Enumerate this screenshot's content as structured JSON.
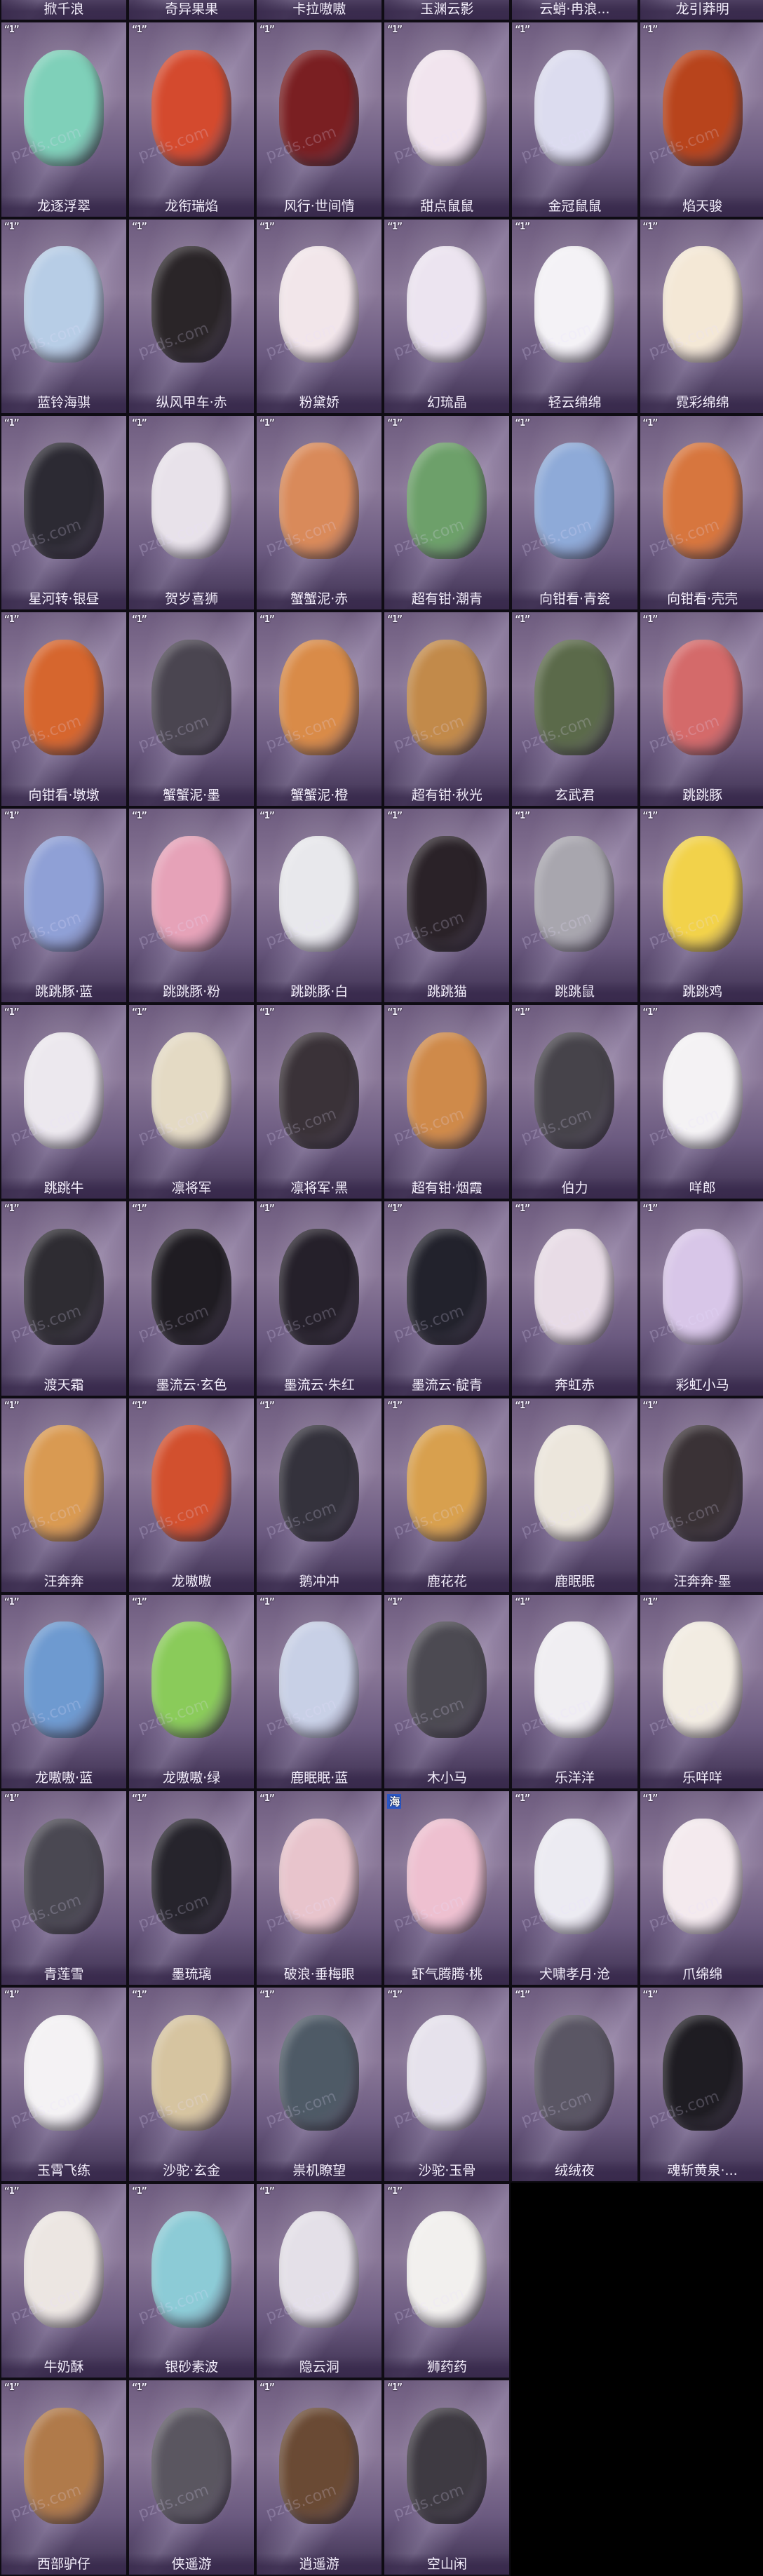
{
  "cards": [
    {
      "label": "掀千浪",
      "tag": "",
      "art": "#8aa1b5"
    },
    {
      "label": "奇异果果",
      "tag": "",
      "art": "#9ab56a"
    },
    {
      "label": "卡拉嗷嗷",
      "tag": "",
      "art": "#b88a6a"
    },
    {
      "label": "玉渊云影",
      "tag": "",
      "art": "#c7d2e4"
    },
    {
      "label": "云蛸·冉浪...",
      "tag": "",
      "art": "#d9c4e6"
    },
    {
      "label": "龙引莽明",
      "tag": "",
      "art": "#d38a5a"
    },
    {
      "label": "龙逐浮翠",
      "tag": "",
      "art": "#7fd0b9"
    },
    {
      "label": "龙衔瑞焰",
      "tag": "",
      "art": "#d44a2e"
    },
    {
      "label": "风行·世间情",
      "tag": "",
      "art": "#7a1f22"
    },
    {
      "label": "甜点鼠鼠",
      "tag": "",
      "art": "#f1e4ee"
    },
    {
      "label": "金冠鼠鼠",
      "tag": "",
      "art": "#dcdcef"
    },
    {
      "label": "焰天骏",
      "tag": "",
      "art": "#b8441c"
    },
    {
      "label": "蓝铃海骐",
      "tag": "",
      "art": "#b7cde6"
    },
    {
      "label": "纵风甲车·赤",
      "tag": "",
      "art": "#2a2528"
    },
    {
      "label": "粉黛娇",
      "tag": "",
      "art": "#f2e6ea"
    },
    {
      "label": "幻琉晶",
      "tag": "",
      "art": "#ece4f0"
    },
    {
      "label": "轻云绵绵",
      "tag": "",
      "art": "#f4f2f6"
    },
    {
      "label": "霓彩绵绵",
      "tag": "",
      "art": "#f4e8d6"
    },
    {
      "label": "星河转·银昼",
      "tag": "",
      "art": "#2c2a33"
    },
    {
      "label": "贺岁喜狮",
      "tag": "",
      "art": "#e8e2ea"
    },
    {
      "label": "蟹蟹泥·赤",
      "tag": "",
      "art": "#d98a5a"
    },
    {
      "label": "超有钳·潮青",
      "tag": "",
      "art": "#6da06a"
    },
    {
      "label": "向钳看·青瓷",
      "tag": "",
      "art": "#8eaad8"
    },
    {
      "label": "向钳看·壳壳",
      "tag": "",
      "art": "#d7763e"
    },
    {
      "label": "向钳看·墩墩",
      "tag": "",
      "art": "#d6662e"
    },
    {
      "label": "蟹蟹泥·墨",
      "tag": "",
      "art": "#4a4550"
    },
    {
      "label": "蟹蟹泥·橙",
      "tag": "",
      "art": "#d98b48"
    },
    {
      "label": "超有钳·秋光",
      "tag": "",
      "art": "#c28a4a"
    },
    {
      "label": "玄武君",
      "tag": "",
      "art": "#5b6a4a"
    },
    {
      "label": "跳跳豚",
      "tag": "",
      "art": "#d46a6a"
    },
    {
      "label": "跳跳豚·蓝",
      "tag": "",
      "art": "#8fa0d6"
    },
    {
      "label": "跳跳豚·粉",
      "tag": "",
      "art": "#e6a2b8"
    },
    {
      "label": "跳跳豚·白",
      "tag": "",
      "art": "#e8e8ec"
    },
    {
      "label": "跳跳猫",
      "tag": "",
      "art": "#2a2228"
    },
    {
      "label": "跳跳鼠",
      "tag": "",
      "art": "#a8a6ae"
    },
    {
      "label": "跳跳鸡",
      "tag": "",
      "art": "#f2d24a"
    },
    {
      "label": "跳跳牛",
      "tag": "",
      "art": "#ece8ee"
    },
    {
      "label": "凛将军",
      "tag": "",
      "art": "#e4dac4"
    },
    {
      "label": "凛将军·黑",
      "tag": "",
      "art": "#3a3238"
    },
    {
      "label": "超有钳·烟霞",
      "tag": "",
      "art": "#cf8a4a"
    },
    {
      "label": "伯力",
      "tag": "",
      "art": "#46434a"
    },
    {
      "label": "咩郎",
      "tag": "",
      "art": "#f4f2f4"
    },
    {
      "label": "渡天霜",
      "tag": "",
      "art": "#2e2c32"
    },
    {
      "label": "墨流云·玄色",
      "tag": "",
      "art": "#1f1c22"
    },
    {
      "label": "墨流云·朱红",
      "tag": "",
      "art": "#25202a"
    },
    {
      "label": "墨流云·靛青",
      "tag": "",
      "art": "#22222c"
    },
    {
      "label": "奔虹赤",
      "tag": "",
      "art": "#e8dce6"
    },
    {
      "label": "彩虹小马",
      "tag": "",
      "art": "#d8c6e8"
    },
    {
      "label": "汪奔奔",
      "tag": "",
      "art": "#d99a52"
    },
    {
      "label": "龙嗷嗷",
      "tag": "",
      "art": "#d2502e"
    },
    {
      "label": "鹅冲冲",
      "tag": "",
      "art": "#34323c"
    },
    {
      "label": "鹿花花",
      "tag": "",
      "art": "#d8a04e"
    },
    {
      "label": "鹿眠眠",
      "tag": "",
      "art": "#ece6dc"
    },
    {
      "label": "汪奔奔·墨",
      "tag": "",
      "art": "#3a3236"
    },
    {
      "label": "龙嗷嗷·蓝",
      "tag": "",
      "art": "#6e9ad0"
    },
    {
      "label": "龙嗷嗷·绿",
      "tag": "",
      "art": "#8acb5a"
    },
    {
      "label": "鹿眠眠·蓝",
      "tag": "",
      "art": "#c8d0e6"
    },
    {
      "label": "木小马",
      "tag": "",
      "art": "#4c4a52"
    },
    {
      "label": "乐洋洋",
      "tag": "",
      "art": "#f0eef2"
    },
    {
      "label": "乐咩咩",
      "tag": "",
      "art": "#f2ece2"
    },
    {
      "label": "青莲雪",
      "tag": "",
      "art": "#4a4852"
    },
    {
      "label": "墨琉璃",
      "tag": "",
      "art": "#26242c"
    },
    {
      "label": "破浪·垂梅眼",
      "tag": "",
      "art": "#e8c4cc"
    },
    {
      "label": "虾气腾腾·桃",
      "tag": "海",
      "art": "#eec0d0"
    },
    {
      "label": "犬啸孝月·沧",
      "tag": "",
      "art": "#ecebf2"
    },
    {
      "label": "爪绵绵",
      "tag": "",
      "art": "#f4eaee"
    },
    {
      "label": "玉霄飞练",
      "tag": "",
      "art": "#f4f2f4"
    },
    {
      "label": "沙驼·玄金",
      "tag": "",
      "art": "#d6c4a0"
    },
    {
      "label": "祟机瞭望",
      "tag": "",
      "art": "#4e5a66"
    },
    {
      "label": "沙驼·玉骨",
      "tag": "",
      "art": "#e6e2ec"
    },
    {
      "label": "绒绒夜",
      "tag": "",
      "art": "#5a5664"
    },
    {
      "label": "魂斩黄泉·...",
      "tag": "",
      "art": "#1e1c22"
    },
    {
      "label": "牛奶酥",
      "tag": "",
      "art": "#ece6e2"
    },
    {
      "label": "银砂素波",
      "tag": "",
      "art": "#8ccbd6"
    },
    {
      "label": "隐云洞",
      "tag": "",
      "art": "#e4e0e8"
    },
    {
      "label": "狮药药",
      "tag": "",
      "art": "#f2f0ee"
    },
    {
      "label": "西部驴仔",
      "tag": "",
      "art": "#b07a4a"
    },
    {
      "label": "侠遥游",
      "tag": "",
      "art": "#5a5660"
    },
    {
      "label": "逍遥游",
      "tag": "",
      "art": "#6a4a34"
    },
    {
      "label": "空山闲",
      "tag": "",
      "art": "#3e3a42"
    }
  ],
  "watermark": "pzds.com",
  "tag_text": "“1”"
}
